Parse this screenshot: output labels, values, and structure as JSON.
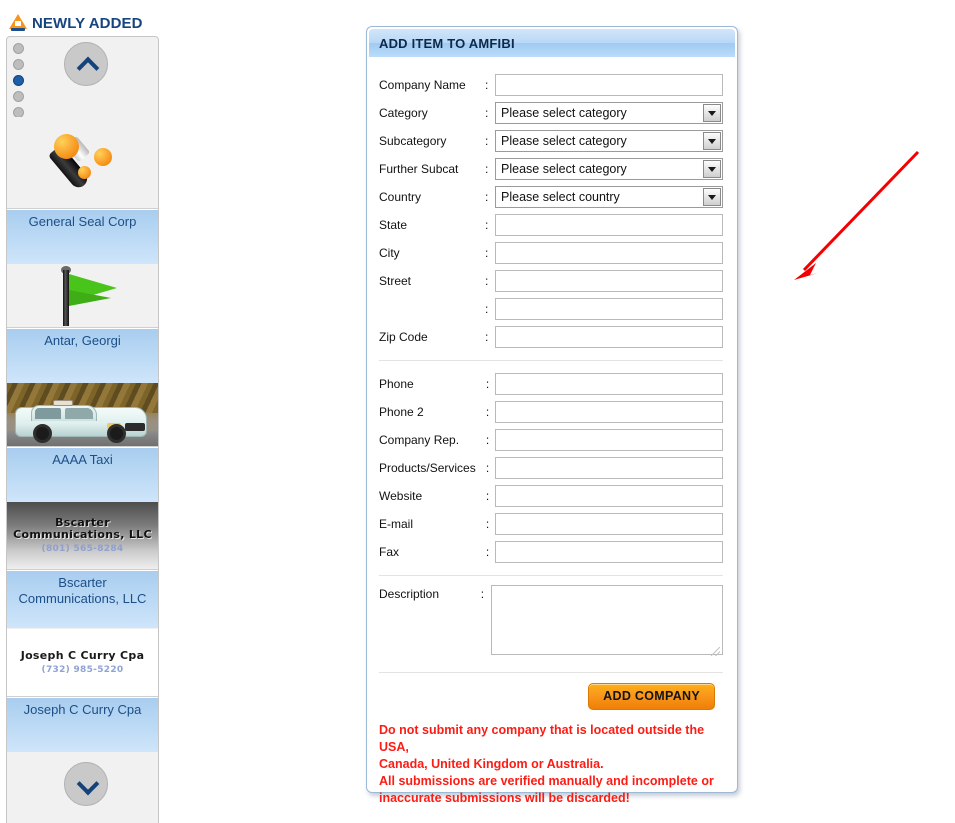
{
  "sidebar": {
    "logo_icon": "amfibi-a-logo-icon",
    "title": "NEWLY ADDED",
    "pager": {
      "total": 5,
      "active_index": 2
    },
    "scroll_up_icon": "chevron-up-icon",
    "scroll_down_icon": "chevron-down-icon",
    "items": [
      {
        "caption": "General Seal Corp",
        "thumb": "test-tube-illustration",
        "logo_text": "",
        "logo_phone": ""
      },
      {
        "caption": "Antar, Georgi",
        "thumb": "green-flag-illustration",
        "logo_text": "",
        "logo_phone": ""
      },
      {
        "caption": "AAAA Taxi",
        "thumb": "taxi-car-photo",
        "logo_text": "",
        "logo_phone": ""
      },
      {
        "caption": "Bscarter Communications, LLC",
        "thumb": "text-logo-dark",
        "logo_text": "Bscarter Communications, LLC",
        "logo_phone": "(801) 565-8284"
      },
      {
        "caption": "Joseph C Curry Cpa",
        "thumb": "text-logo-light",
        "logo_text": "Joseph C Curry Cpa",
        "logo_phone": "(732) 985-5220"
      }
    ]
  },
  "form": {
    "header_title": "ADD ITEM TO AMFIBI",
    "fields_top": [
      {
        "label": "Company Name",
        "type": "text",
        "value": ""
      },
      {
        "label": "Category",
        "type": "select",
        "value": "Please select category"
      },
      {
        "label": "Subcategory",
        "type": "select",
        "value": "Please select category"
      },
      {
        "label": "Further Subcat",
        "type": "select",
        "value": "Please select category"
      },
      {
        "label": "Country",
        "type": "select",
        "value": "Please select country"
      },
      {
        "label": "State",
        "type": "text",
        "value": ""
      },
      {
        "label": "City",
        "type": "text",
        "value": ""
      },
      {
        "label": "Street",
        "type": "text",
        "value": ""
      },
      {
        "label": "",
        "type": "text",
        "value": ""
      },
      {
        "label": "Zip Code",
        "type": "text",
        "value": ""
      }
    ],
    "fields_contact": [
      {
        "label": "Phone",
        "type": "text",
        "value": ""
      },
      {
        "label": "Phone 2",
        "type": "text",
        "value": ""
      },
      {
        "label": "Company Rep.",
        "type": "text",
        "value": ""
      },
      {
        "label": "Products/Services",
        "type": "text",
        "value": ""
      },
      {
        "label": "Website",
        "type": "text",
        "value": ""
      },
      {
        "label": "E-mail",
        "type": "text",
        "value": ""
      },
      {
        "label": "Fax",
        "type": "text",
        "value": ""
      }
    ],
    "description": {
      "label": "Description",
      "value": ""
    },
    "colon": ":",
    "submit_label": "ADD COMPANY",
    "warning_lines": [
      "Do not submit any company that is located outside the USA,",
      "Canada, United Kingdom or Australia.",
      "All submissions are verified manually and incomplete or",
      "inaccurate submissions will be discarded!"
    ]
  },
  "annotation": {
    "icon": "red-arrow-annotation",
    "color": "#f40000"
  },
  "colors": {
    "brand_orange": "#f7941e",
    "title_blue": "#17457f",
    "caption_blue": "#1c4f88",
    "warning_red": "#fd1c14",
    "panel_border": "#9cb9d6"
  }
}
